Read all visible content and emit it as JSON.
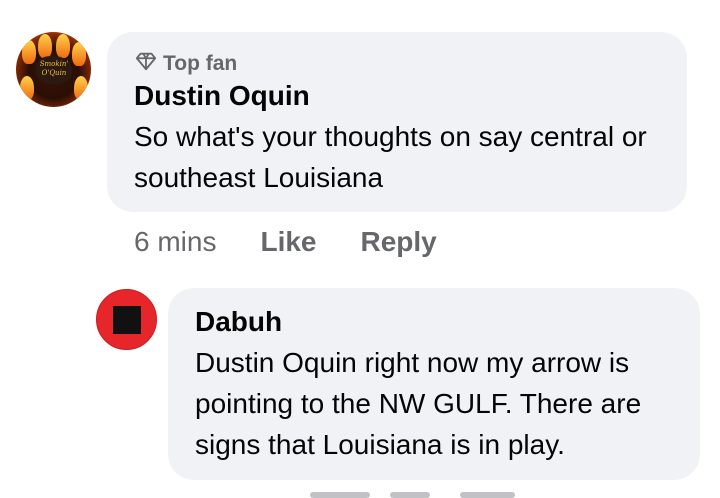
{
  "comment": {
    "badge": "Top fan",
    "author": "Dustin Oquin",
    "text": "So what's your thoughts on say central or southeast Louisiana",
    "time": "6 mins",
    "like_label": "Like",
    "reply_label": "Reply",
    "avatar_text": "Smokin' O'Quin"
  },
  "reply": {
    "author": "Dabuh",
    "text": "Dustin Oquin right now my arrow is pointing to the NW GULF. There are signs that Louisiana is in play."
  },
  "icons": {
    "badge_icon": "diamond-icon"
  },
  "colors": {
    "bubble": "#f0f2f5",
    "secondary_text": "#65676b",
    "avatar_red": "#e6262a"
  }
}
